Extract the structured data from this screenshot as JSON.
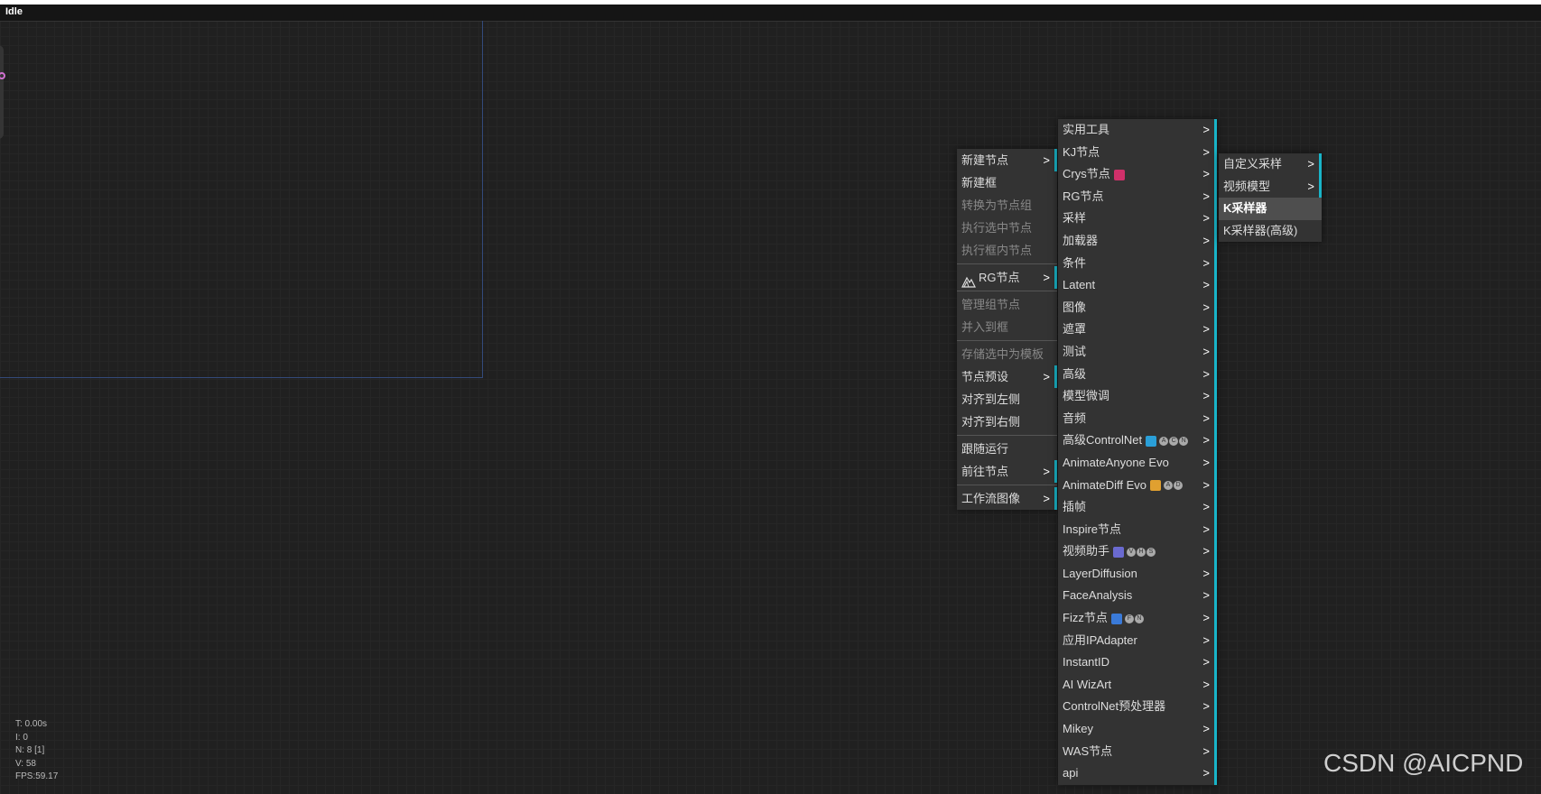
{
  "status": "Idle",
  "stats": [
    "T: 0.00s",
    "I: 0",
    "N: 8 [1]",
    "V: 58",
    "FPS:59.17"
  ],
  "watermark": "CSDN @AICPND",
  "context_menu": [
    {
      "label": "新建节点",
      "submenu": true,
      "disabled": false
    },
    {
      "label": "新建框",
      "submenu": false,
      "disabled": false
    },
    {
      "label": "转换为节点组",
      "submenu": false,
      "disabled": true
    },
    {
      "label": "执行选中节点",
      "submenu": false,
      "disabled": true
    },
    {
      "label": "执行框内节点",
      "submenu": false,
      "disabled": true
    },
    {
      "separator": true
    },
    {
      "label": "RG节点",
      "submenu": true,
      "disabled": false,
      "icon": "mountain-icon"
    },
    {
      "separator": true
    },
    {
      "label": "管理组节点",
      "submenu": false,
      "disabled": true
    },
    {
      "label": "并入到框",
      "submenu": false,
      "disabled": true
    },
    {
      "separator": true
    },
    {
      "label": "存储选中为模板",
      "submenu": false,
      "disabled": true
    },
    {
      "label": "节点预设",
      "submenu": true,
      "disabled": false
    },
    {
      "label": "对齐到左侧",
      "submenu": false,
      "disabled": false
    },
    {
      "label": "对齐到右侧",
      "submenu": false,
      "disabled": false
    },
    {
      "separator": true
    },
    {
      "label": "跟随运行",
      "submenu": false,
      "disabled": false
    },
    {
      "label": "前往节点",
      "submenu": true,
      "disabled": false
    },
    {
      "separator": true
    },
    {
      "label": "工作流图像",
      "submenu": true,
      "disabled": false
    }
  ],
  "node_categories": [
    {
      "label": "实用工具"
    },
    {
      "label": "KJ节点"
    },
    {
      "label": "Crys节点",
      "icon": "screwdriver-icon"
    },
    {
      "label": "RG节点"
    },
    {
      "label": "采样"
    },
    {
      "label": "加载器"
    },
    {
      "label": "条件"
    },
    {
      "label": "Latent"
    },
    {
      "label": "图像"
    },
    {
      "label": "遮罩"
    },
    {
      "label": "测试"
    },
    {
      "label": "高级"
    },
    {
      "label": "模型微调"
    },
    {
      "label": "音频"
    },
    {
      "label": "高级ControlNet",
      "icon": "controlnet-icon",
      "badges": [
        "A",
        "C",
        "N"
      ]
    },
    {
      "label": "AnimateAnyone Evo"
    },
    {
      "label": "AnimateDiff Evo",
      "icon": "masks-icon",
      "badges": [
        "A",
        "D"
      ]
    },
    {
      "label": "插帧"
    },
    {
      "label": "Inspire节点"
    },
    {
      "label": "视频助手",
      "icon": "people-icon",
      "badges": [
        "V",
        "H",
        "S"
      ]
    },
    {
      "label": "LayerDiffusion"
    },
    {
      "label": "FaceAnalysis"
    },
    {
      "label": "Fizz节点",
      "icon": "calendar-icon",
      "badges": [
        "F",
        "N"
      ]
    },
    {
      "label": "应用IPAdapter"
    },
    {
      "label": "InstantID"
    },
    {
      "label": "AI WizArt"
    },
    {
      "label": "ControlNet预处理器"
    },
    {
      "label": "Mikey"
    },
    {
      "label": "WAS节点"
    },
    {
      "label": "api"
    }
  ],
  "sampler_menu": [
    {
      "label": "自定义采样",
      "submenu": true
    },
    {
      "label": "视频模型",
      "submenu": true
    },
    {
      "label": "K采样器",
      "submenu": false,
      "selected": true
    },
    {
      "label": "K采样器(高级)",
      "submenu": false
    }
  ],
  "colors": {
    "accent": "#19b4c8",
    "menu_bg": "#333333",
    "canvas_bg": "#202020"
  }
}
